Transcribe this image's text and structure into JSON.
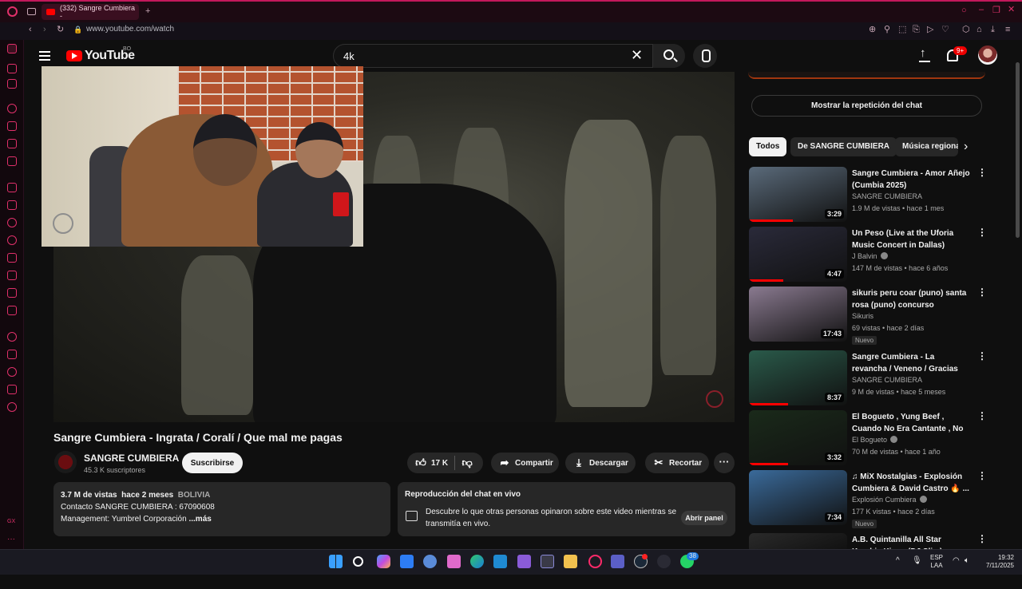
{
  "browser": {
    "tab_title": "(332) Sangre Cumbiera -",
    "url": "www.youtube.com/watch"
  },
  "header": {
    "logo_text": "YouTube",
    "region": "BO",
    "search_value": "4k",
    "notifications_badge": "9+"
  },
  "video": {
    "title": "Sangre Cumbiera - Ingrata / Coralí / Que mal me pagas",
    "channel_name": "SANGRE CUMBIERA",
    "subscribers": "45.3 K suscriptores",
    "subscribe_label": "Suscribirse",
    "likes": "17 K",
    "share_label": "Compartir",
    "download_label": "Descargar",
    "clip_label": "Recortar",
    "more_label": "···"
  },
  "description": {
    "views": "3.7 M de vistas",
    "date": "hace 2 meses",
    "country": "BOLIVIA",
    "line2": "Contacto SANGRE CUMBIERA : 67090608",
    "line3": "Management: Yumbrel Corporación",
    "more": "...más"
  },
  "live_chat": {
    "title": "Reproducción del chat en vivo",
    "description": "Descubre lo que otras personas opinaron sobre este video mientras se transmitía en vivo.",
    "button": "Abrir panel"
  },
  "sidebar": {
    "replay_button": "Mostrar la repetición del chat",
    "chips": [
      "Todos",
      "De SANGRE CUMBIERA",
      "Música regional"
    ],
    "recommendations": [
      {
        "title": "Sangre Cumbiera - Amor Añejo (Cumbia 2025)",
        "channel": "SANGRE CUMBIERA",
        "verified": false,
        "meta": "1.9 M de vistas • hace 1 mes",
        "duration": "3:29",
        "new": "",
        "progress": 0.45,
        "color": "#5a6a7a"
      },
      {
        "title": "Un Peso (Live at the Uforia Music Concert in Dallas)",
        "channel": "J Balvin",
        "verified": true,
        "meta": "147 M de vistas • hace 6 años",
        "duration": "4:47",
        "new": "",
        "progress": 0.35,
        "color": "#2a2a3a"
      },
      {
        "title": "sikuris peru coar (puno) santa rosa (puno) concurso zampoñ...",
        "channel": "Sikuris",
        "verified": false,
        "meta": "69 vistas • hace 2 días",
        "duration": "17:43",
        "new": "Nuevo",
        "progress": 0.0,
        "color": "#8a7a90"
      },
      {
        "title": "Sangre Cumbiera - La revancha / Veneno / Gracias (Cumbia ...",
        "channel": "SANGRE CUMBIERA",
        "verified": false,
        "meta": "9 M de vistas • hace 5 meses",
        "duration": "8:37",
        "new": "",
        "progress": 0.4,
        "color": "#2a5a4a"
      },
      {
        "title": "El Bogueto , Yung Beef , Cuando No Era Cantante , No Hay Loco...",
        "channel": "El Bogueto",
        "verified": true,
        "meta": "70 M de vistas • hace 1 año",
        "duration": "3:32",
        "new": "",
        "progress": 0.4,
        "color": "#1a2a1a"
      },
      {
        "title": "♫ MiX Nostalgias - Explosión Cumbiera & David Castro 🔥 ...",
        "channel": "Explosión Cumbiera",
        "verified": true,
        "meta": "177 K vistas • hace 2 días",
        "duration": "7:34",
        "new": "Nuevo",
        "progress": 0.0,
        "color": "#3a6a9a"
      },
      {
        "title": "A.B. Quintanilla All Star Kumbia Kings (DJ Slim)",
        "channel": "",
        "verified": false,
        "meta": "",
        "duration": "",
        "new": "",
        "progress": 0.0,
        "color": "#2a2a2a"
      }
    ]
  },
  "taskbar": {
    "lang": "ESP",
    "lang2": "LAA",
    "time": "19:32",
    "date": "7/11/2025",
    "whatsapp_badge": "38"
  },
  "colors": {
    "accent": "#c2185b",
    "youtube_red": "#ff0000"
  }
}
